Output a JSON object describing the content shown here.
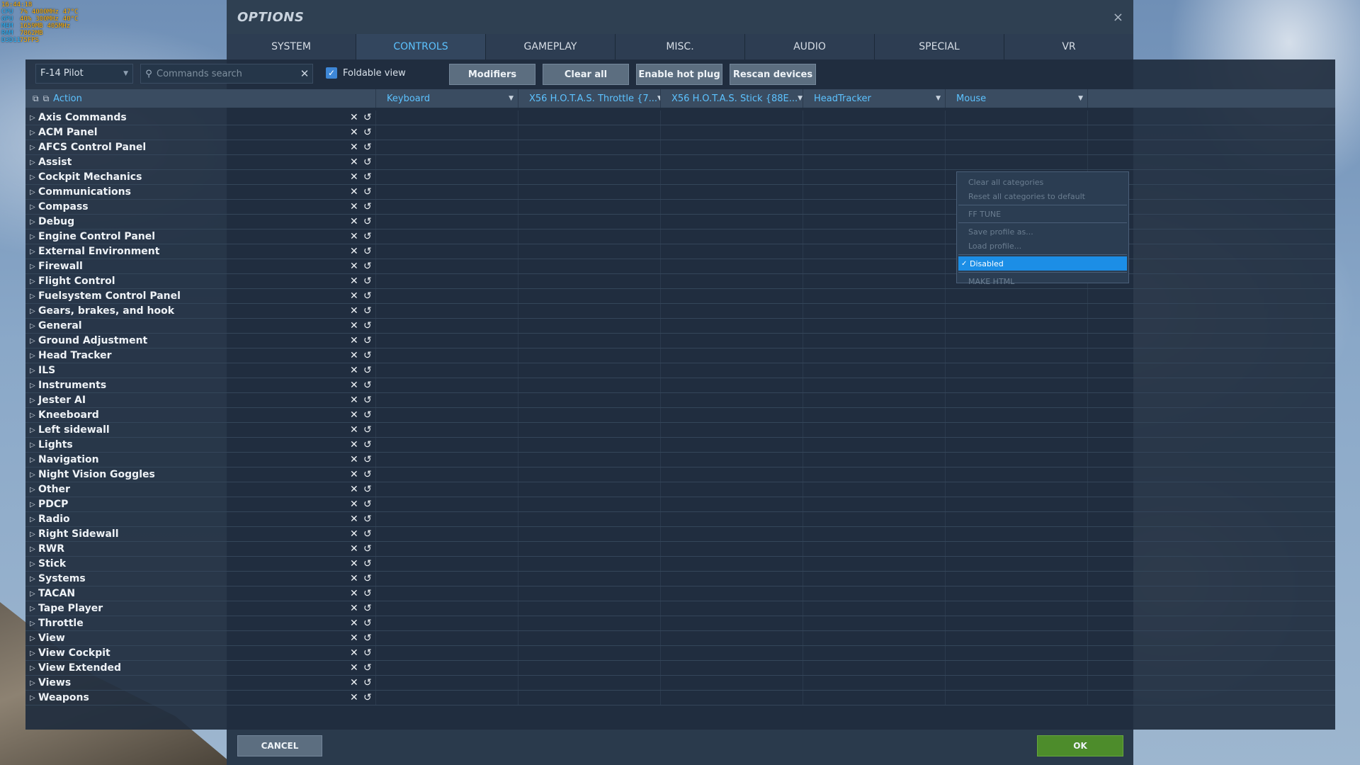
{
  "hud": {
    "time": "16:44:18",
    "rows": [
      {
        "label": "CPU",
        "a": "7%",
        "b": "4000MHz",
        "c": "47°C"
      },
      {
        "label": "GPU",
        "a": "40%",
        "b": "300MHz",
        "c": "40°C"
      },
      {
        "label": "MEM",
        "a": "1659MB",
        "b": "405MHz",
        "c": ""
      },
      {
        "label": "RAM",
        "a": "7862MB",
        "b": "",
        "c": ""
      },
      {
        "label": "D3D11",
        "a": "75FPS",
        "b": "",
        "c": ""
      }
    ]
  },
  "dialog": {
    "title": "OPTIONS",
    "close_icon": "×"
  },
  "tabs": [
    {
      "label": "SYSTEM",
      "active": false
    },
    {
      "label": "CONTROLS",
      "active": true
    },
    {
      "label": "GAMEPLAY",
      "active": false
    },
    {
      "label": "MISC.",
      "active": false
    },
    {
      "label": "AUDIO",
      "active": false
    },
    {
      "label": "SPECIAL",
      "active": false
    },
    {
      "label": "VR",
      "active": false
    }
  ],
  "toolbar": {
    "profile": "F-14 Pilot",
    "search_placeholder": "Commands search",
    "search_value": "",
    "foldable_label": "Foldable view",
    "foldable_checked": true,
    "modifiers_label": "Modifiers",
    "clear_all_label": "Clear all",
    "hot_plug_label": "Enable hot plug",
    "rescan_label": "Rescan devices"
  },
  "header": {
    "action_label": "Action",
    "columns": [
      "Keyboard",
      "X56 H.O.T.A.S. Throttle {7...",
      "X56 H.O.T.A.S. Stick {88E...",
      "HeadTracker",
      "Mouse"
    ]
  },
  "categories": [
    "Axis Commands",
    "ACM Panel",
    "AFCS Control Panel",
    "Assist",
    "Cockpit Mechanics",
    "Communications",
    "Compass",
    "Debug",
    "Engine Control Panel",
    "External Environment",
    "Firewall",
    "Flight Control",
    "Fuelsystem Control Panel",
    "Gears, brakes, and hook",
    "General",
    "Ground Adjustment",
    "Head Tracker",
    "ILS",
    "Instruments",
    "Jester AI",
    "Kneeboard",
    "Left sidewall",
    "Lights",
    "Navigation",
    "Night Vision Goggles",
    "Other",
    "PDCP",
    "Radio",
    "Right Sidewall",
    "RWR",
    "Stick",
    "Systems",
    "TACAN",
    "Tape Player",
    "Throttle",
    "View",
    "View Cockpit",
    "View Extended",
    "Views",
    "Weapons"
  ],
  "context_menu": {
    "items": [
      {
        "label": "Clear all categories"
      },
      {
        "label": "Reset all categories to default"
      },
      {
        "label": "FF TUNE"
      },
      {
        "label": "Save profile as..."
      },
      {
        "label": "Load profile..."
      },
      {
        "label": "Disabled",
        "selected": true
      },
      {
        "label": "MAKE HTML"
      }
    ]
  },
  "footer": {
    "cancel_label": "CANCEL",
    "ok_label": "OK"
  },
  "colors": {
    "accent": "#5cc2ff",
    "ok_button": "#4d8c2b",
    "selection": "#1c8ee6"
  }
}
